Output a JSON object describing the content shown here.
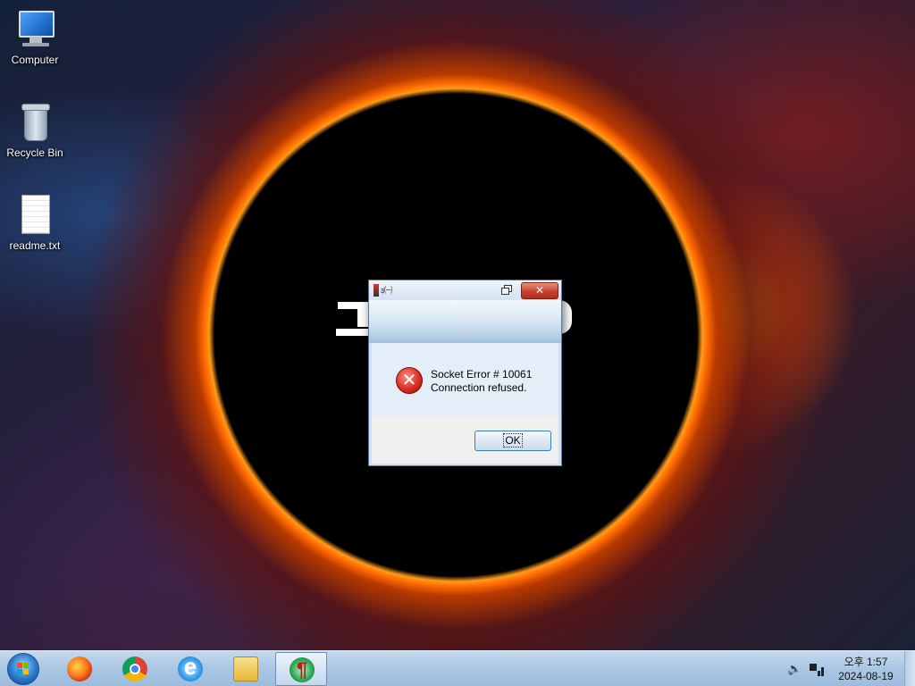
{
  "desktop": {
    "icons": [
      {
        "label": "Computer",
        "icon": "computer-icon"
      },
      {
        "label": "Recycle Bin",
        "icon": "recycle-bin-icon"
      },
      {
        "label": "readme.txt",
        "icon": "text-file-icon"
      }
    ]
  },
  "dialog": {
    "title": "ɜ̣̇㈠",
    "message_line1": "Socket Error # 10061",
    "message_line2": "Connection refused.",
    "ok_label": "OK",
    "close_glyph": "✕",
    "icon": "error-icon"
  },
  "taskbar": {
    "pinned": [
      {
        "name": "Firefox",
        "icon": "firefox-icon"
      },
      {
        "name": "Google Chrome",
        "icon": "chrome-icon"
      },
      {
        "name": "Internet Explorer",
        "icon": "internet-explorer-icon"
      },
      {
        "name": "File Explorer",
        "icon": "folder-icon"
      },
      {
        "name": "Running application",
        "icon": "app-icon",
        "active": true
      }
    ],
    "clock_time": "오후 1:57",
    "clock_date": "2024-08-19"
  },
  "colors": {
    "taskbar": "#a9c6e4",
    "close_button": "#c74330",
    "error_icon": "#d42a1f"
  }
}
